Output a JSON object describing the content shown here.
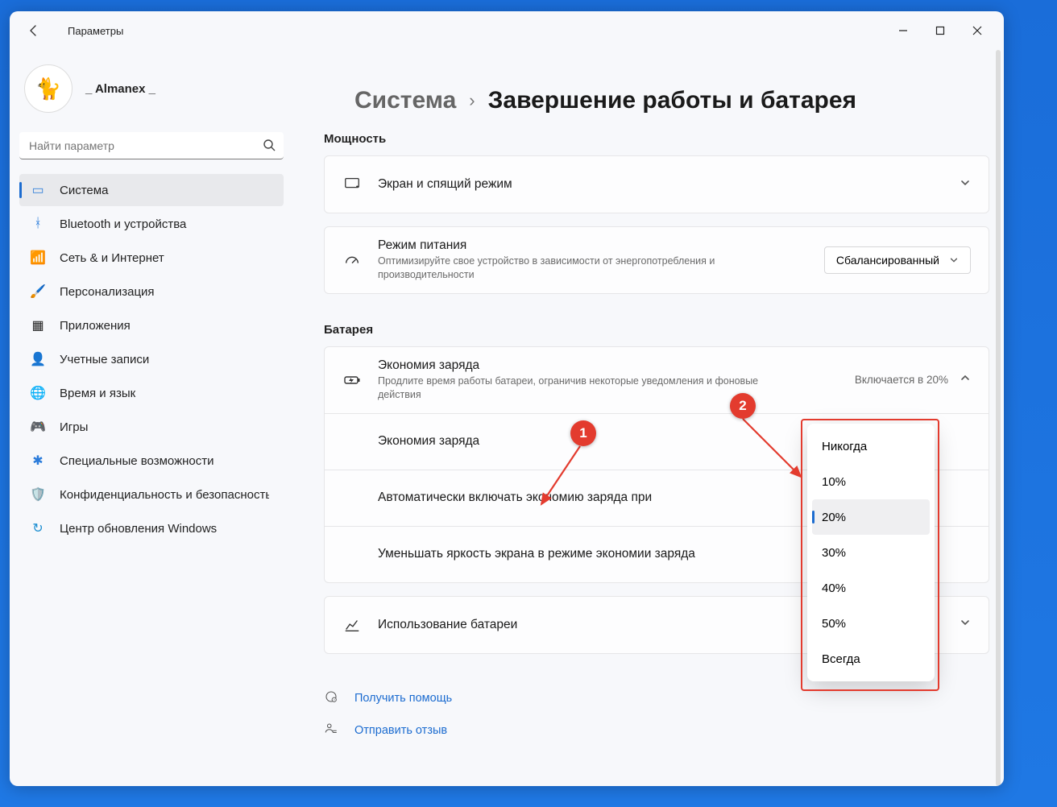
{
  "window": {
    "app_title": "Параметры",
    "user_name": "_ Almanex _",
    "search_placeholder": "Найти параметр"
  },
  "sidebar": {
    "items": [
      {
        "id": "system",
        "label": "Система"
      },
      {
        "id": "bluetooth",
        "label": "Bluetooth и устройства"
      },
      {
        "id": "network",
        "label": "Сеть & и Интернет"
      },
      {
        "id": "personalization",
        "label": "Персонализация"
      },
      {
        "id": "apps",
        "label": "Приложения"
      },
      {
        "id": "accounts",
        "label": "Учетные записи"
      },
      {
        "id": "time",
        "label": "Время и язык"
      },
      {
        "id": "gaming",
        "label": "Игры"
      },
      {
        "id": "accessibility",
        "label": "Специальные возможности"
      },
      {
        "id": "privacy",
        "label": "Конфиденциальность и безопасность"
      },
      {
        "id": "windowsupdate",
        "label": "Центр обновления Windows"
      }
    ]
  },
  "breadcrumb": {
    "parent": "Система",
    "title": "Завершение работы и батарея"
  },
  "power": {
    "section": "Мощность",
    "screen": {
      "title": "Экран и спящий режим"
    },
    "mode": {
      "title": "Режим питания",
      "sub": "Оптимизируйте свое устройство в зависимости от энергопотребления и производительности",
      "value": "Сбалансированный"
    }
  },
  "battery": {
    "section": "Батарея",
    "saver": {
      "title": "Экономия заряда",
      "sub": "Продлите время работы батареи, ограничив некоторые уведомления и фоновые действия",
      "value": "Включается в 20%"
    },
    "saver_row": {
      "title": "Экономия заряда"
    },
    "auto_on": {
      "title": "Автоматически включать экономию заряда при"
    },
    "dim": {
      "title": "Уменьшать яркость экрана в режиме экономии заряда"
    },
    "usage": {
      "title": "Использование батареи"
    }
  },
  "dropdown_options": [
    "Никогда",
    "10%",
    "20%",
    "30%",
    "40%",
    "50%",
    "Всегда"
  ],
  "dropdown_selected": "20%",
  "footer": {
    "help": "Получить помощь",
    "feedback": "Отправить отзыв"
  },
  "annotations": {
    "1": "1",
    "2": "2"
  }
}
